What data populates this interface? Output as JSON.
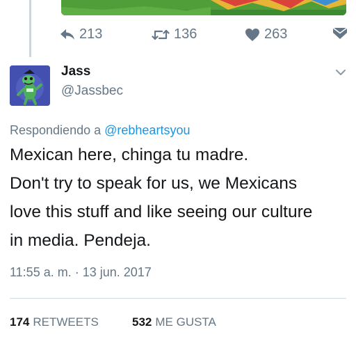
{
  "previous_tweet": {
    "actions": {
      "replies": "213",
      "retweets": "136",
      "likes": "263"
    }
  },
  "tweet": {
    "display_name": "Jass",
    "handle": "@Jassbec",
    "reply_prefix": "Respondiendo a",
    "reply_mention": "@rebheartsyou",
    "text_lines": [
      "Mexican here, chinga tu madre.",
      "Don't try to speak for us, we Mexicans",
      "love this stuff and like seeing our culture",
      "in media. Pendeja."
    ],
    "timestamp": "11:55 a. m. · 13 jun. 2017",
    "stats": {
      "retweet_count": "174",
      "retweet_label": "RETWEETS",
      "like_count": "532",
      "like_label": "ME GUSTA"
    }
  },
  "colors": {
    "muted": "#657786",
    "link": "#1b95e0",
    "text": "#14171a",
    "thread_line": "#ccd6dd"
  },
  "icons": [
    "reply-icon",
    "retweet-icon",
    "heart-icon",
    "direct-message-icon",
    "chevron-down-icon"
  ]
}
